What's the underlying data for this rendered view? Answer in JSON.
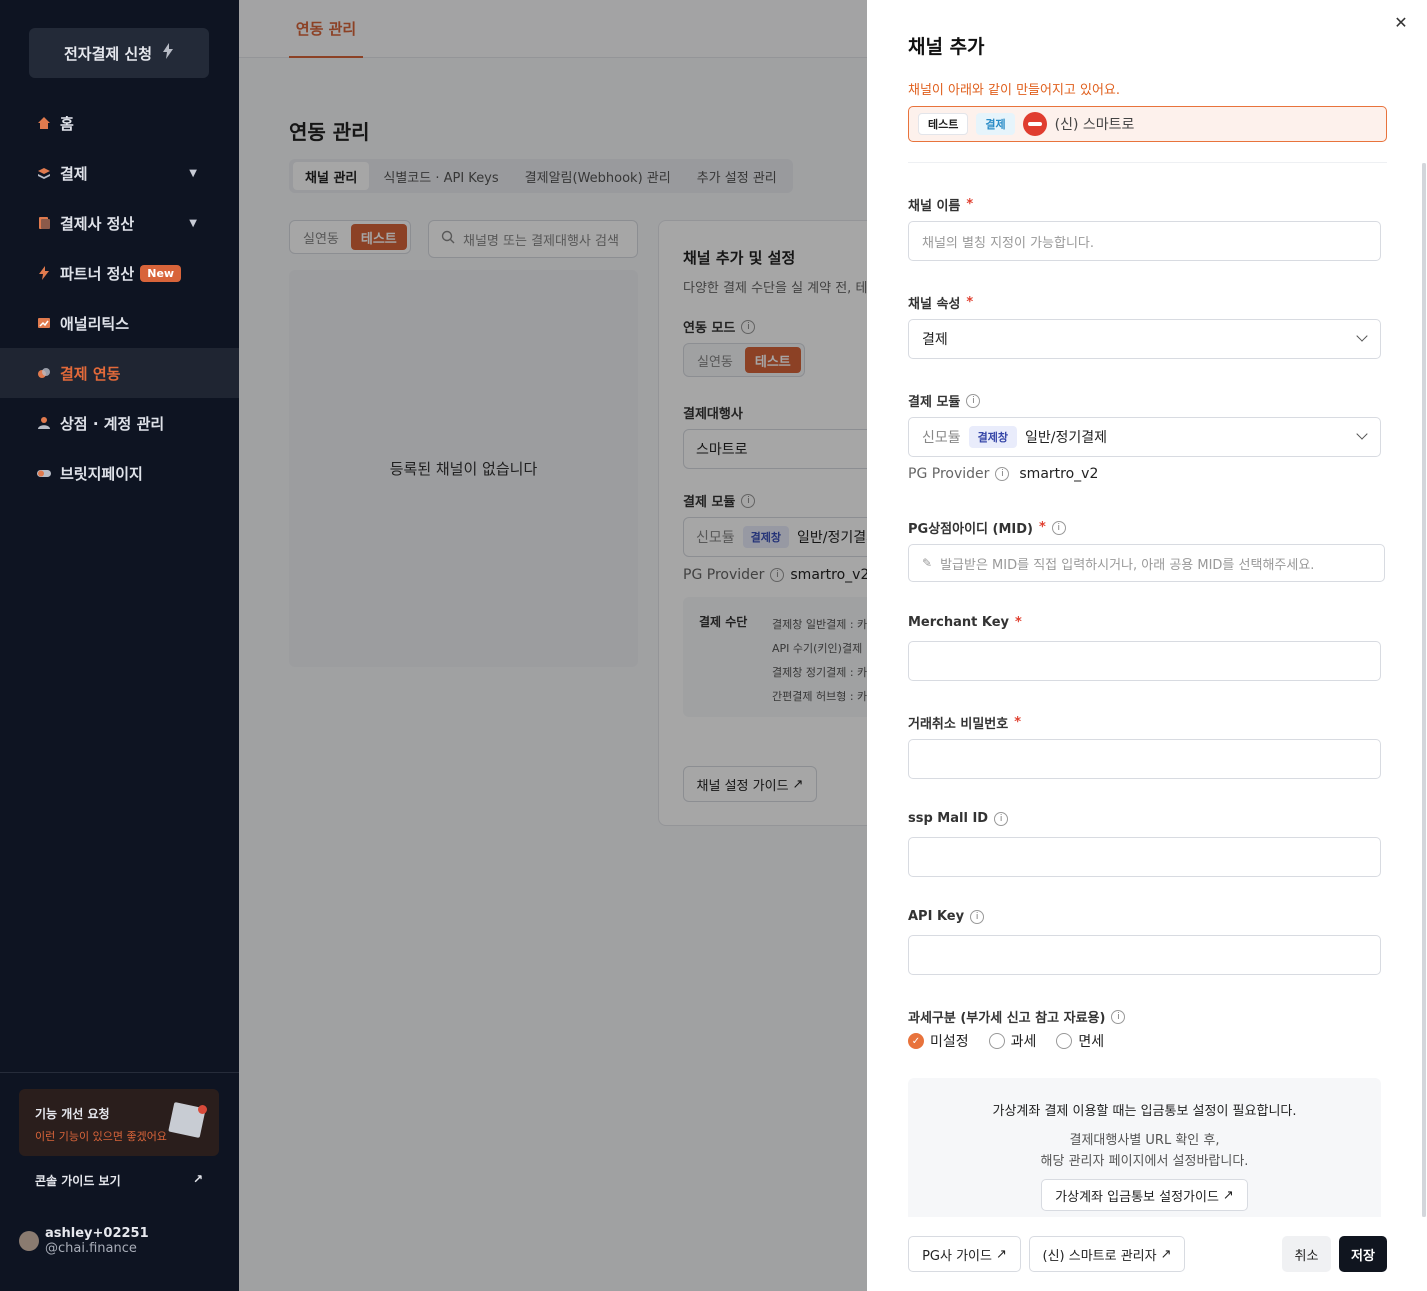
{
  "sidebar": {
    "apply_button": "전자결제 신청",
    "items": [
      {
        "label": "홈",
        "icon": "home-icon"
      },
      {
        "label": "결제",
        "icon": "layers-icon",
        "expandable": true
      },
      {
        "label": "결제사 정산",
        "icon": "document-icon",
        "expandable": true
      },
      {
        "label": "파트너 정산",
        "icon": "bolt-icon",
        "badge": "New"
      },
      {
        "label": "애널리틱스",
        "icon": "chart-icon"
      },
      {
        "label": "결제 연동",
        "icon": "link-icon",
        "active": true
      },
      {
        "label": "상점 · 계정 관리",
        "icon": "users-icon"
      },
      {
        "label": "브릿지페이지",
        "icon": "toggle-icon"
      }
    ],
    "feedback": {
      "title": "기능 개선 요청",
      "subtitle": "이런 기능이 있으면 좋겠어요"
    },
    "console_guide": "콘솔 가이드 보기",
    "user": {
      "name": "ashley+02251",
      "domain": "@chai.finance"
    }
  },
  "main": {
    "top_tab": "연동 관리",
    "page_title": "연동 관리",
    "subtabs": [
      "채널 관리",
      "식별코드 · API Keys",
      "결제알림(Webhook) 관리",
      "추가 설정 관리"
    ],
    "mode_toggle": [
      "실연동",
      "테스트"
    ],
    "search_placeholder": "채널명 또는 결제대행사 검색",
    "empty_message": "등록된 채널이 없습니다",
    "card": {
      "title": "채널 추가 및 설정",
      "desc": "다양한 결제 수단을 실 계약 전, 테",
      "mode_label": "연동 모드",
      "mode_options": [
        "실연동",
        "테스트"
      ],
      "pg_label": "결제대행사",
      "pg_value": "스마트로",
      "module_label": "결제 모듈",
      "module_prefix": "신모듈",
      "module_tag": "결제창",
      "module_value": "일반/정기결제",
      "provider_label": "PG Provider",
      "provider_value": "smartro_v2",
      "methods_label": "결제 수단",
      "methods": [
        "결제창 일반결제 : 카",
        "API 수기(키인)결제",
        "결제창 정기결제 : 카",
        "간편결제 허브형 : 카"
      ],
      "guide_button": "채널 설정 가이드"
    }
  },
  "drawer": {
    "title": "채널 추가",
    "notice": "채널이 아래와 같이 만들어지고 있어요.",
    "preview": {
      "chip1": "테스트",
      "chip2": "결제",
      "pg_name": "(신) 스마트로",
      "logo_color": "#e03d2f"
    },
    "fields": {
      "channel_name": {
        "label": "채널 이름",
        "placeholder": "채널의 별칭 지정이 가능합니다."
      },
      "channel_attr": {
        "label": "채널 속성",
        "value": "결제"
      },
      "module": {
        "label": "결제 모듈",
        "prefix": "신모듈",
        "tag": "결제창",
        "value": "일반/정기결제"
      },
      "pg_provider": {
        "label": "PG Provider",
        "value": "smartro_v2"
      },
      "mid": {
        "label": "PG상점아이디 (MID)",
        "placeholder": "발급받은 MID를 직접 입력하시거나, 아래 공용 MID를 선택해주세요."
      },
      "merchant_key": {
        "label": "Merchant Key"
      },
      "cancel_password": {
        "label": "거래취소 비밀번호"
      },
      "ssp_mall_id": {
        "label": "ssp Mall ID"
      },
      "api_key": {
        "label": "API Key"
      },
      "tax": {
        "label": "과세구분 (부가세 신고 참고 자료용)",
        "options": [
          "미설정",
          "과세",
          "면세"
        ],
        "selected": "미설정"
      }
    },
    "va_box": {
      "main": "가상계좌 결제 이용할 때는 입금통보 설정이 필요합니다.",
      "sub1": "결제대행사별 URL 확인 후,",
      "sub2": "해당 관리자 페이지에서 설정바랍니다.",
      "button": "가상계좌 입금통보 설정가이드"
    },
    "footer": {
      "pg_guide": "PG사 가이드",
      "pg_admin": "(신) 스마트로 관리자",
      "cancel": "취소",
      "save": "저장"
    }
  },
  "colors": {
    "accent": "#d8643a",
    "sidebar_bg": "#0e1422",
    "required": "#e04030"
  }
}
